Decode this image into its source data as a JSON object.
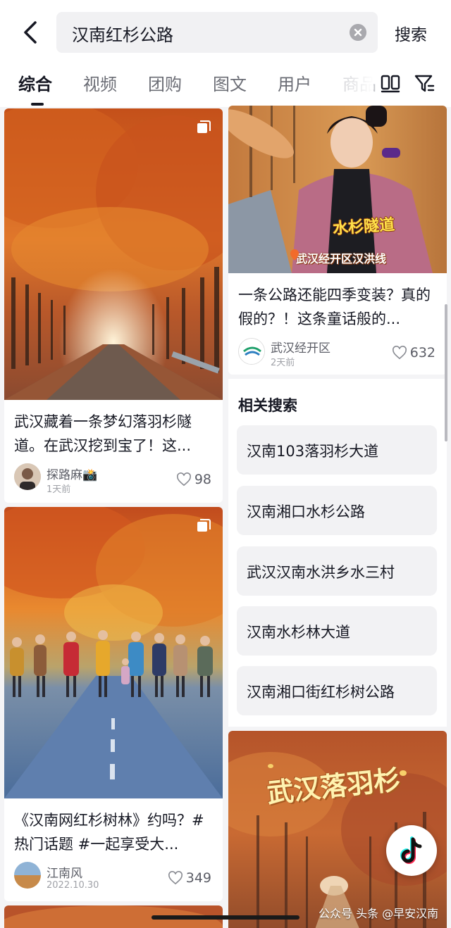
{
  "search": {
    "query": "汉南红杉公路",
    "submit_label": "搜索"
  },
  "tabs": [
    {
      "label": "综合",
      "active": true
    },
    {
      "label": "视频"
    },
    {
      "label": "团购"
    },
    {
      "label": "图文"
    },
    {
      "label": "用户"
    },
    {
      "label": "商品"
    }
  ],
  "results": {
    "left_col": [
      {
        "title": "武汉藏着一条梦幻落羽杉隧道。在武汉挖到宝了！这...",
        "author": "探路麻📸",
        "time": "1天前",
        "likes": "98"
      },
      {
        "title": "《汉南网红杉树林》约吗？#热门话题 #一起享受大...",
        "author": "江南风",
        "time": "2022.10.30",
        "likes": "349"
      }
    ],
    "right_col": [
      {
        "overlay_title": "水杉隧道",
        "overlay_location": "武汉经开区汉洪线",
        "title": "一条公路还能四季变装？真的假的？！这条童话般的...",
        "author": "武汉经开区",
        "time": "2天前",
        "likes": "632"
      },
      {
        "overlay_title": "武汉落羽杉"
      }
    ]
  },
  "related_searches": {
    "title": "相关搜索",
    "items": [
      "汉南103落羽杉大道",
      "汉南湘口水杉公路",
      "武汉汉南水洪乡水三村",
      "汉南水杉林大道",
      "汉南湘口街红杉树公路"
    ]
  },
  "watermark": "公众号 头条 @早安汉南",
  "colors": {
    "accent_text": "#161823",
    "muted_text": "#5b5d66",
    "chip_bg": "#f2f2f4",
    "page_bg": "#f4f4f6"
  }
}
